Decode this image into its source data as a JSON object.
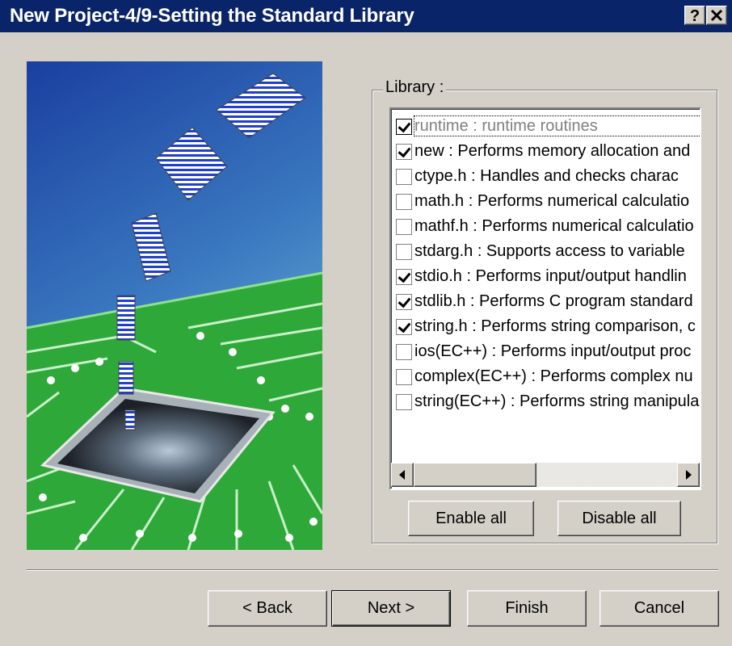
{
  "window": {
    "title": "New Project-4/9-Setting the Standard Library",
    "help_label": "?",
    "close_label": "✕"
  },
  "library": {
    "legend": "Library :",
    "items": [
      {
        "label": "runtime : runtime routines",
        "checked": true,
        "enabled": false
      },
      {
        "label": "new : Performs memory allocation and",
        "checked": true,
        "enabled": true
      },
      {
        "label": "ctype.h : Handles and checks charac",
        "checked": false,
        "enabled": true
      },
      {
        "label": "math.h : Performs numerical calculatio",
        "checked": false,
        "enabled": true
      },
      {
        "label": "mathf.h : Performs numerical calculatio",
        "checked": false,
        "enabled": true
      },
      {
        "label": "stdarg.h : Supports access to variable",
        "checked": false,
        "enabled": true
      },
      {
        "label": "stdio.h : Performs input/output handlin",
        "checked": true,
        "enabled": true
      },
      {
        "label": "stdlib.h : Performs C program standard",
        "checked": true,
        "enabled": true
      },
      {
        "label": "string.h : Performs string comparison, c",
        "checked": true,
        "enabled": true
      },
      {
        "label": "ios(EC++) : Performs input/output proc",
        "checked": false,
        "enabled": true
      },
      {
        "label": "complex(EC++) : Performs complex nu",
        "checked": false,
        "enabled": true
      },
      {
        "label": "string(EC++) : Performs string manipula",
        "checked": false,
        "enabled": true
      }
    ],
    "enable_all_label": "Enable all",
    "disable_all_label": "Disable all"
  },
  "footer": {
    "back_label": "< Back",
    "next_label": "Next >",
    "finish_label": "Finish",
    "cancel_label": "Cancel"
  },
  "colors": {
    "title_bar": "#0a246a",
    "face": "#d4d0c8",
    "sky_top": "#1a3fa0",
    "sky_bottom": "#5fa8c8",
    "pcb_green": "#2fa83a",
    "doc_stripe": "#2040c8"
  }
}
